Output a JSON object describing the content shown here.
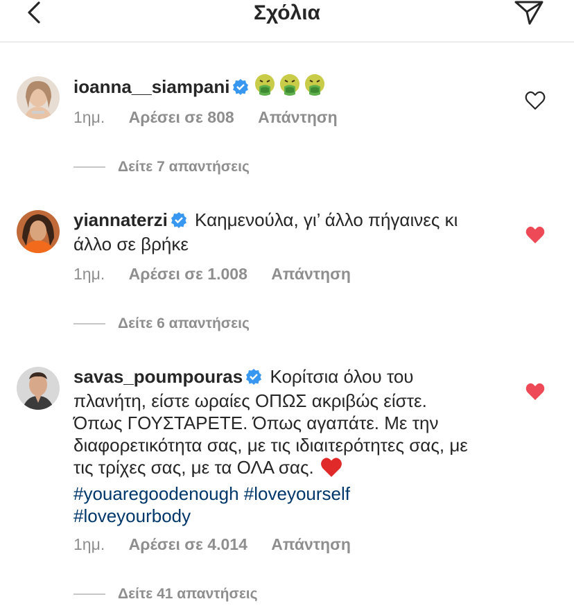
{
  "header": {
    "title": "Σχόλια"
  },
  "comments": [
    {
      "username": "ioanna__siampani",
      "text": "",
      "time": "1ημ.",
      "likes": "Αρέσει σε 808",
      "reply": "Απάντηση",
      "view_replies": "Δείτε 7 απαντήσεις",
      "liked": false
    },
    {
      "username": "yiannaterzi",
      "text": "Καημενούλα, γι’ άλλο πήγαινες κι άλλο σε βρήκε",
      "time": "1ημ.",
      "likes": "Αρέσει σε 1.008",
      "reply": "Απάντηση",
      "view_replies": "Δείτε 6 απαντήσεις",
      "liked": true
    },
    {
      "username": "savas_poumpouras",
      "text": "Κορίτσια όλου του πλανήτη, είστε ωραίες ΟΠΩΣ ακριβώς είστε. Όπως ΓΟΥΣΤΑΡΕΤΕ. Όπως αγαπάτε. Με την διαφορετικότητα σας, με τις ιδιαιτερότητες σας, με τις τρίχες σας, με τα ΟΛΑ σας.",
      "hashtags": [
        "#youaregoodenough",
        "#loveyourself",
        "#loveyourbody"
      ],
      "time": "1ημ.",
      "likes": "Αρέσει σε 4.014",
      "reply": "Απάντηση",
      "view_replies": "Δείτε 41 απαντήσεις",
      "liked": true
    }
  ],
  "colors": {
    "liked": "#ed4956",
    "verified": "#3897f0",
    "hashtag": "#00376b",
    "secondary": "#8e8e8e"
  }
}
